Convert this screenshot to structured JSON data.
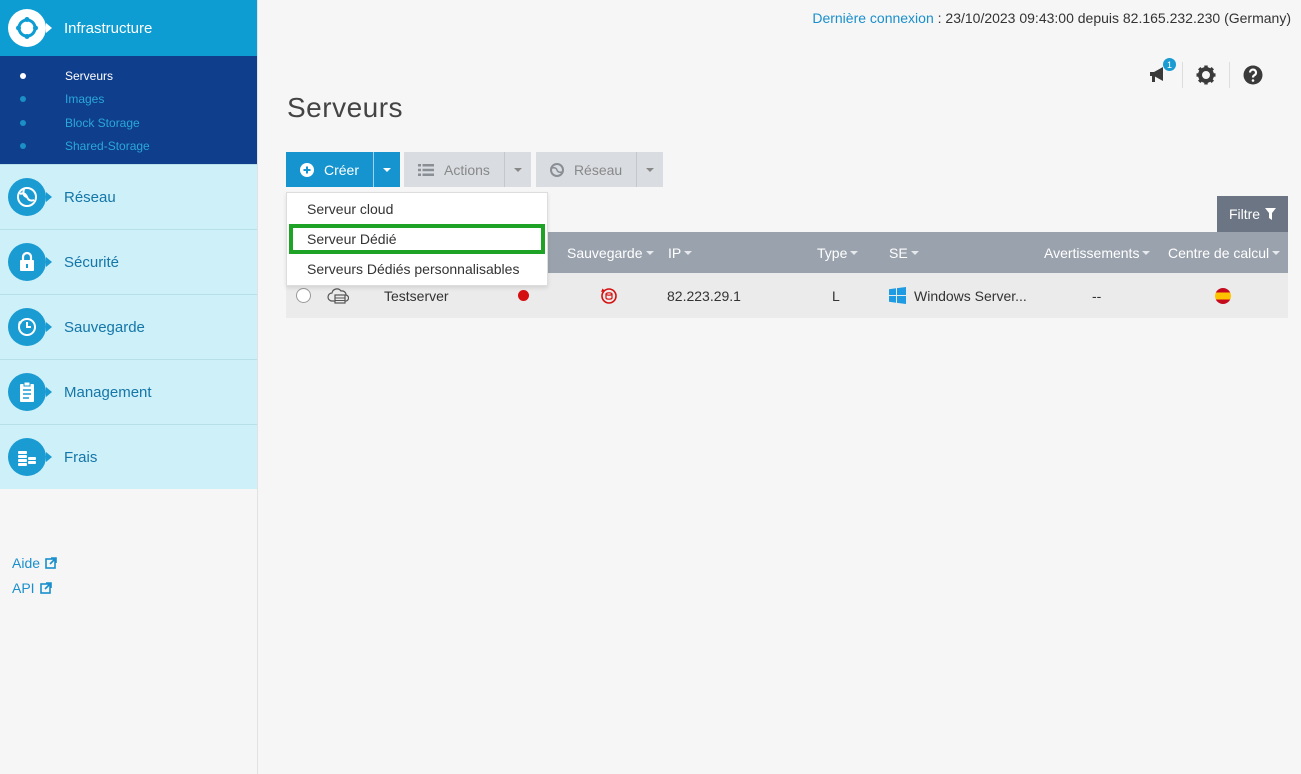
{
  "sidebar": {
    "main_item": {
      "label": "Infrastructure",
      "icon": "infrastructure-icon"
    },
    "sub_items": [
      {
        "label": "Serveurs",
        "active": true
      },
      {
        "label": "Images",
        "active": false
      },
      {
        "label": "Block Storage",
        "active": false
      },
      {
        "label": "Shared-Storage",
        "active": false
      }
    ],
    "items": [
      {
        "label": "Réseau",
        "icon": "network-globe-icon"
      },
      {
        "label": "Sécurité",
        "icon": "lock-icon"
      },
      {
        "label": "Sauvegarde",
        "icon": "backup-clock-icon"
      },
      {
        "label": "Management",
        "icon": "clipboard-icon"
      },
      {
        "label": "Frais",
        "icon": "coins-icon"
      }
    ],
    "links": [
      {
        "label": "Aide",
        "icon": "external-link-icon"
      },
      {
        "label": "API",
        "icon": "external-link-icon"
      }
    ]
  },
  "header": {
    "last_login_label": "Dernière connexion",
    "last_login_value": " : 23/10/2023 09:43:00 depuis 82.165.232.230 (Germany)",
    "notification_count": "1"
  },
  "page": {
    "title": "Serveurs"
  },
  "toolbar": {
    "create_label": "Créer",
    "actions_label": "Actions",
    "network_label": "Réseau"
  },
  "create_menu": {
    "items": [
      {
        "label": "Serveur cloud",
        "highlighted": false
      },
      {
        "label": "Serveur Dédié",
        "highlighted": true
      },
      {
        "label": "Serveurs Dédiés personnalisables",
        "highlighted": false
      }
    ]
  },
  "filter": {
    "label": "Filtre"
  },
  "table": {
    "columns": [
      "Sauvegarde",
      "IP",
      "Type",
      "SE",
      "Avertissements",
      "Centre de calcul"
    ],
    "rows": [
      {
        "name": "Testserver",
        "status": "stopped",
        "ip": "82.223.29.1",
        "type": "L",
        "os": "Windows Server...",
        "warnings": "--",
        "datacenter": "spain-flag"
      }
    ]
  },
  "colors": {
    "accent": "#1594cf",
    "sidebar_sub_bg": "#0f3e8c",
    "sidebar_item_bg": "#cdf0f9",
    "highlight_outline": "#1fa327",
    "status_red": "#d50f0f"
  }
}
